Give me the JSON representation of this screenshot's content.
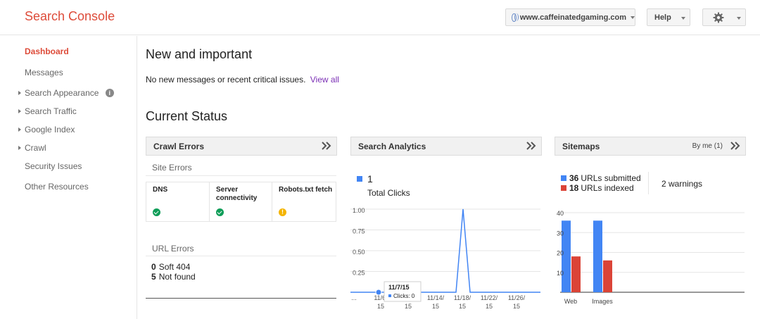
{
  "header": {
    "brand": "Search Console",
    "site": "www.caffeinatedgaming.com",
    "help_label": "Help"
  },
  "sidebar": {
    "items": [
      {
        "label": "Dashboard",
        "active": true,
        "expandable": false
      },
      {
        "label": "Messages",
        "active": false,
        "expandable": false
      },
      {
        "label": "Search Appearance",
        "active": false,
        "expandable": true,
        "info": "i"
      },
      {
        "label": "Search Traffic",
        "active": false,
        "expandable": true
      },
      {
        "label": "Google Index",
        "active": false,
        "expandable": true
      },
      {
        "label": "Crawl",
        "active": false,
        "expandable": true
      },
      {
        "label": "Security Issues",
        "active": false,
        "expandable": false
      },
      {
        "label": "Other Resources",
        "active": false,
        "expandable": false
      }
    ]
  },
  "main": {
    "new_title": "New and important",
    "notice_text": "No new messages or recent critical issues.",
    "view_all": "View all",
    "status_title": "Current Status"
  },
  "crawl": {
    "title": "Crawl Errors",
    "site_errors_label": "Site Errors",
    "columns": [
      {
        "label": "DNS",
        "status": "ok"
      },
      {
        "label": "Server connectivity",
        "status": "ok"
      },
      {
        "label": "Robots.txt fetch",
        "status": "warning",
        "glyph": "!"
      }
    ],
    "url_errors_label": "URL Errors",
    "url_errors": [
      {
        "count": "0",
        "label": "Soft 404"
      },
      {
        "count": "5",
        "label": "Not found"
      }
    ]
  },
  "analytics": {
    "title": "Search Analytics",
    "metric_value": "1",
    "metric_label": "Total Clicks",
    "tooltip_date": "11/7/15",
    "tooltip_value": "Clicks: 0"
  },
  "sitemaps": {
    "title": "Sitemaps",
    "filter": "By me (1)",
    "submitted_count": "36",
    "submitted_label": "URLs submitted",
    "indexed_count": "18",
    "indexed_label": "URLs indexed",
    "warnings": "2 warnings"
  },
  "colors": {
    "accent_red": "#dd4b39",
    "series_blue": "#4285f4",
    "series_red": "#db4437",
    "ok_green": "#0f9d58",
    "warn_yellow": "#f4b400"
  },
  "chart_data": [
    {
      "type": "line",
      "series": [
        {
          "name": "Total Clicks",
          "color": "#4285f4"
        }
      ],
      "x_tick_labels": [
        "...",
        "11/6/15",
        "11/10/15",
        "11/14/15",
        "11/18/15",
        "11/22/15",
        "11/26/15"
      ],
      "y_tick_labels": [
        "1.00",
        "0.75",
        "0.50",
        "0.25"
      ],
      "ylim": [
        0,
        1
      ],
      "points": [
        {
          "x": "11/3/15",
          "y": 0
        },
        {
          "x": "11/7/15",
          "y": 0
        },
        {
          "x": "11/18/15",
          "y": 0
        },
        {
          "x": "11/19/15",
          "y": 1
        },
        {
          "x": "11/20/15",
          "y": 0
        },
        {
          "x": "11/30/15",
          "y": 0
        }
      ],
      "xlim": [
        "11/3/15",
        "11/30/15"
      ],
      "grid": true
    },
    {
      "type": "bar",
      "categories": [
        "Web",
        "Images"
      ],
      "series": [
        {
          "name": "URLs submitted",
          "color": "#4285f4",
          "values": [
            36,
            36
          ]
        },
        {
          "name": "URLs indexed",
          "color": "#db4437",
          "values": [
            18,
            16
          ]
        }
      ],
      "y_tick_labels": [
        "40",
        "30",
        "20",
        "10"
      ],
      "ylim": [
        0,
        40
      ],
      "grid": true
    }
  ]
}
